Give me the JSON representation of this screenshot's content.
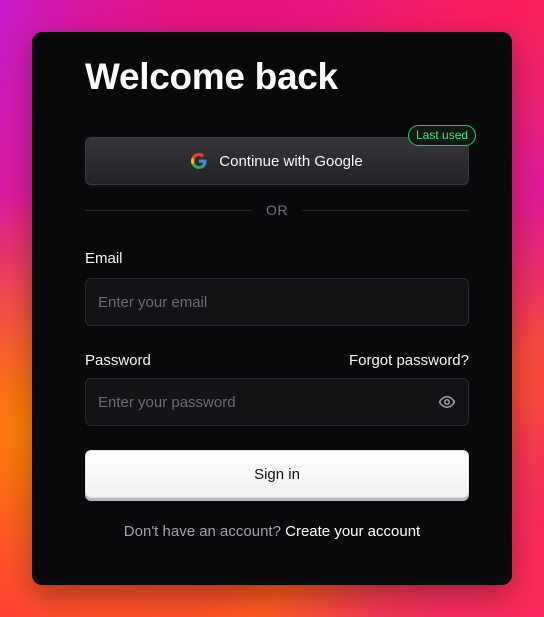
{
  "page": {
    "title": "Welcome back"
  },
  "google": {
    "label": "Continue with Google",
    "icon": "google-icon",
    "badge": "Last used",
    "badge_color": "#4ade80"
  },
  "divider": {
    "text": "OR"
  },
  "email": {
    "label": "Email",
    "value": "",
    "placeholder": "Enter your email"
  },
  "password": {
    "label": "Password",
    "forgot_label": "Forgot password?",
    "value": "",
    "placeholder": "Enter your password",
    "toggle_icon": "eye-icon"
  },
  "actions": {
    "signin_label": "Sign in"
  },
  "footer": {
    "prompt": "Don't have an account?",
    "link": "Create your account"
  },
  "colors": {
    "card_background": "#09090b",
    "primary_button": "#ffffff",
    "text": "#f4f4f5",
    "muted_text": "#a1a1aa"
  }
}
